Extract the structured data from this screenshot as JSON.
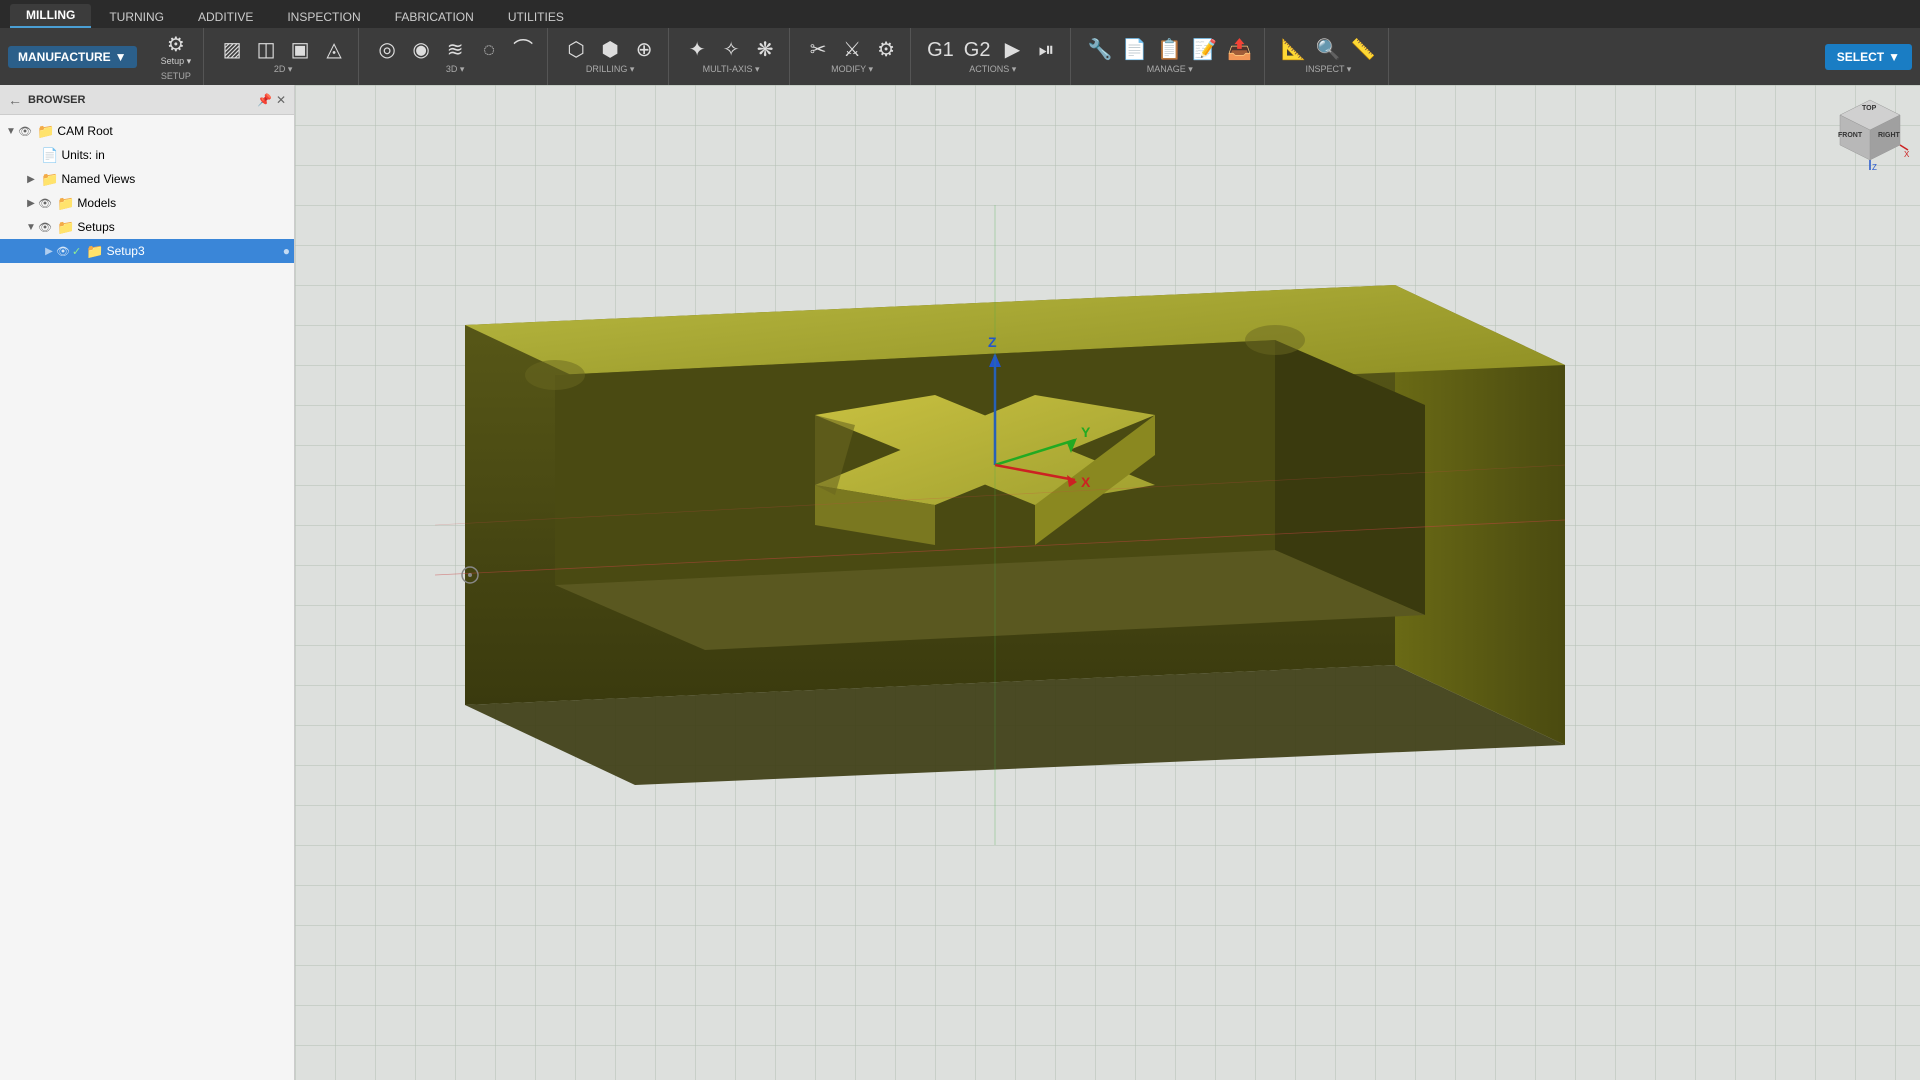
{
  "tabs": [
    {
      "label": "MILLING",
      "active": true
    },
    {
      "label": "TURNING",
      "active": false
    },
    {
      "label": "ADDITIVE",
      "active": false
    },
    {
      "label": "INSPECTION",
      "active": false
    },
    {
      "label": "FABRICATION",
      "active": false
    },
    {
      "label": "UTILITIES",
      "active": false
    }
  ],
  "manufacture_btn": "MANUFACTURE",
  "ribbon": {
    "groups": [
      {
        "label": "SETUP",
        "buttons": [
          {
            "icon": "⚙",
            "label": "Setup"
          },
          {
            "icon": "▼",
            "label": ""
          }
        ]
      },
      {
        "label": "2D",
        "buttons": [
          {
            "icon": "◈",
            "label": "2D"
          },
          {
            "icon": "▼",
            "label": ""
          }
        ]
      },
      {
        "label": "3D",
        "buttons": [
          {
            "icon": "◉",
            "label": "3D"
          },
          {
            "icon": "▼",
            "label": ""
          }
        ]
      },
      {
        "label": "DRILLING",
        "buttons": [
          {
            "icon": "⬡",
            "label": "Drilling"
          },
          {
            "icon": "▼",
            "label": ""
          }
        ]
      },
      {
        "label": "MULTI-AXIS",
        "buttons": [
          {
            "icon": "✦",
            "label": "Multi"
          },
          {
            "icon": "▼",
            "label": ""
          }
        ]
      },
      {
        "label": "MODIFY",
        "buttons": [
          {
            "icon": "✂",
            "label": "Modify"
          },
          {
            "icon": "▼",
            "label": ""
          }
        ]
      },
      {
        "label": "ACTIONS",
        "buttons": [
          {
            "icon": "▶",
            "label": "Actions"
          },
          {
            "icon": "▼",
            "label": ""
          }
        ]
      },
      {
        "label": "MANAGE",
        "buttons": [
          {
            "icon": "📋",
            "label": "Manage"
          },
          {
            "icon": "▼",
            "label": ""
          }
        ]
      },
      {
        "label": "INSPECT",
        "buttons": [
          {
            "icon": "🔍",
            "label": "Inspect"
          },
          {
            "icon": "▼",
            "label": ""
          }
        ]
      }
    ]
  },
  "select_btn": "SELECT",
  "browser": {
    "title": "BROWSER",
    "items": [
      {
        "id": "cam-root",
        "label": "CAM Root",
        "level": 0,
        "expanded": true,
        "has_arrow": true,
        "icon": "📁",
        "show_eye": true
      },
      {
        "id": "units",
        "label": "Units: in",
        "level": 1,
        "expanded": false,
        "has_arrow": false,
        "icon": "📄",
        "show_eye": false
      },
      {
        "id": "named-views",
        "label": "Named Views",
        "level": 1,
        "expanded": false,
        "has_arrow": true,
        "icon": "📁",
        "show_eye": false
      },
      {
        "id": "models",
        "label": "Models",
        "level": 1,
        "expanded": false,
        "has_arrow": true,
        "icon": "📁",
        "show_eye": true
      },
      {
        "id": "setups",
        "label": "Setups",
        "level": 1,
        "expanded": true,
        "has_arrow": true,
        "icon": "📁",
        "show_eye": true
      },
      {
        "id": "setup3",
        "label": "Setup3",
        "level": 2,
        "expanded": false,
        "has_arrow": false,
        "icon": "📁",
        "show_eye": true,
        "active": true
      }
    ]
  },
  "viewport": {
    "grid_color": "#c8ccca"
  },
  "axis_cube": {
    "front_label": "FRONT",
    "right_label": "RIGHT"
  }
}
